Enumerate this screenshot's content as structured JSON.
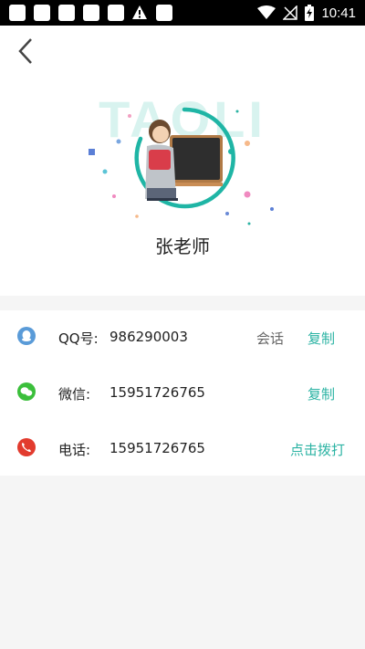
{
  "status_bar": {
    "time": "10:41",
    "icons": [
      "notification-icon",
      "notification-icon",
      "notification-icon",
      "notification-icon",
      "notification-icon",
      "warning-icon",
      "notification-icon",
      "wifi-icon",
      "no-signal-icon",
      "battery-charging-icon"
    ]
  },
  "header": {
    "banner_text": "TAOLI"
  },
  "teacher": {
    "name": "张老师"
  },
  "contacts": {
    "qq": {
      "label": "QQ号:",
      "value": "986290003",
      "chat_label": "会话",
      "copy_label": "复制",
      "icon": "qq-icon"
    },
    "wechat": {
      "label": "微信:",
      "value": "15951726765",
      "copy_label": "复制",
      "icon": "wechat-icon"
    },
    "phone": {
      "label": "电话:",
      "value": "15951726765",
      "call_label": "点击拨打",
      "icon": "phone-icon"
    }
  },
  "colors": {
    "accent": "#2bb3a3",
    "qq_icon": "#5a9bd8",
    "wechat_icon": "#3bbf3b",
    "phone_icon": "#e23b2e"
  }
}
